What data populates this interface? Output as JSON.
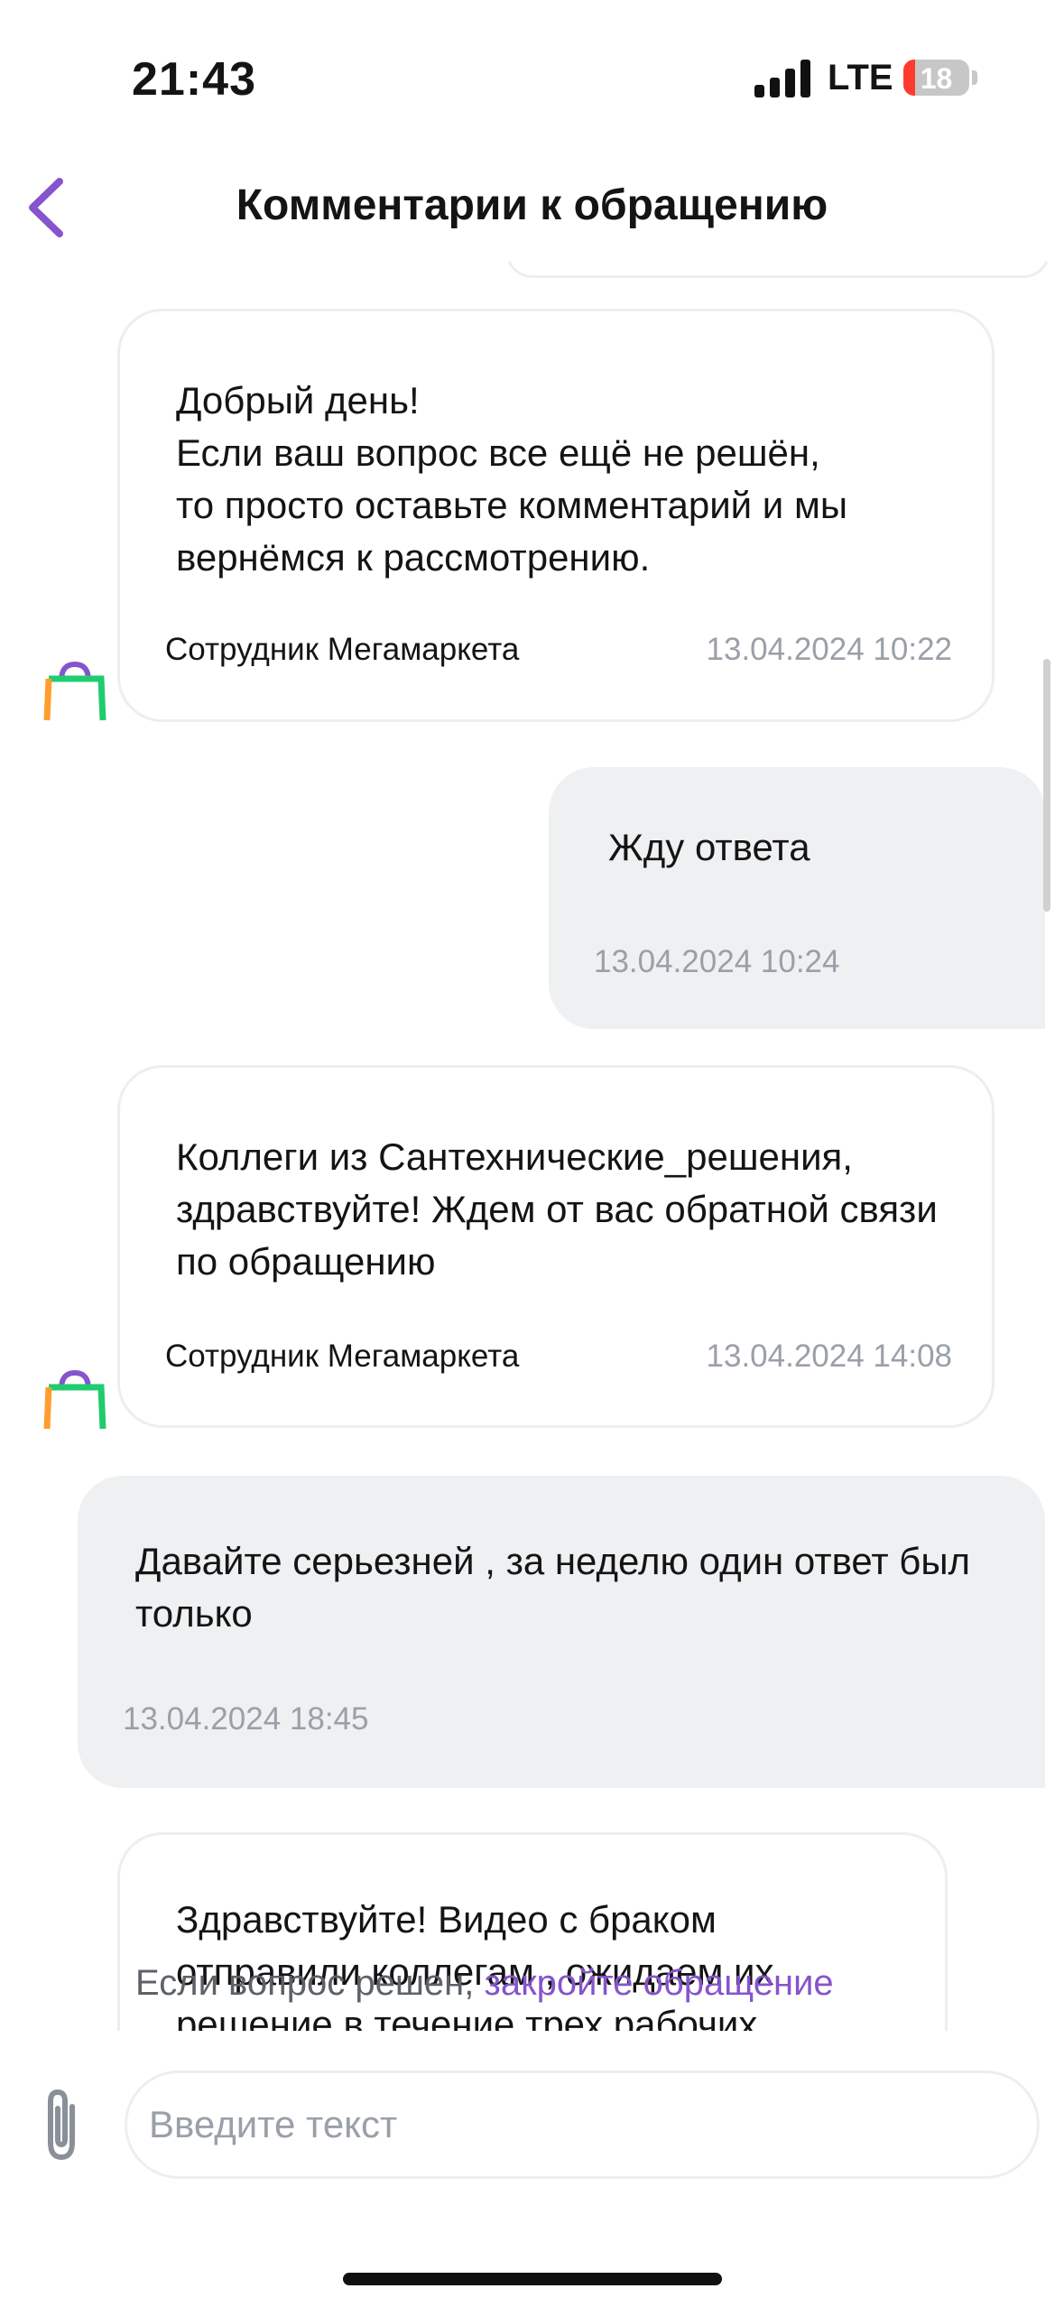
{
  "status_bar": {
    "time": "21:43",
    "network": "LTE",
    "battery": "18",
    "battery_level": 0.18
  },
  "header": {
    "title": "Комментарии к обращению",
    "back_icon": "chevron-left-icon"
  },
  "messages": [
    {
      "direction": "incoming",
      "text": "Добрый день!\nЕсли ваш вопрос все ещё не решён,\nто просто оставьте комментарий и мы вернёмся к рассмотрению.",
      "author": "Сотрудник Мегамаркета",
      "time": "13.04.2024 10:22"
    },
    {
      "direction": "outgoing",
      "text": "Жду ответа",
      "time": "13.04.2024 10:24"
    },
    {
      "direction": "incoming",
      "text": "Коллеги из Сантехнические_решения, здравствуйте! Ждем от вас обратной связи по обращению",
      "author": "Сотрудник Мегамаркета",
      "time": "13.04.2024 14:08"
    },
    {
      "direction": "outgoing",
      "text": "Давайте серьезней , за неделю один ответ был только",
      "time": "13.04.2024 18:45"
    },
    {
      "direction": "incoming",
      "text": "Здравствуйте! Видео с браком отправили коллегам , ожидаем их решение в течение трех рабочих"
    }
  ],
  "resolved_hint": {
    "prefix": "Если вопрос решен, ",
    "link": "закройте обращение"
  },
  "composer": {
    "placeholder": "Введите текст",
    "attach_icon": "paperclip-icon"
  },
  "colors": {
    "accent": "#8654cc",
    "outgoing_bg": "#eef0f2",
    "muted_text": "#9aa0a8",
    "battery_low": "#ff3b30"
  }
}
